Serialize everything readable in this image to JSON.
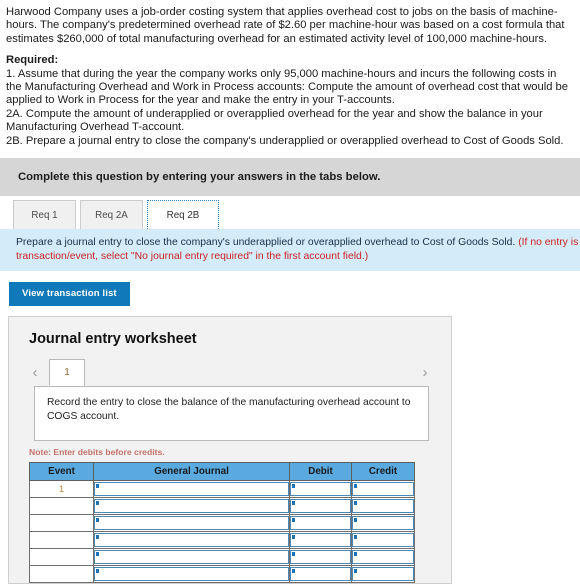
{
  "problem": {
    "paragraph1": "Harwood Company uses a job-order costing system that applies overhead cost to jobs on the basis of machine-hours. The company's predetermined overhead rate of $2.60 per machine-hour was based on a cost formula that estimates $260,000 of total manufacturing overhead for an estimated activity level of 100,000 machine-hours.",
    "required_label": "Required:",
    "requirement1": "1. Assume that during the year the company works only 95,000 machine-hours and incurs the following costs in the Manufacturing Overhead and Work in Process accounts: Compute the amount of overhead cost that would be applied to Work in Process for the year and make the entry in your T-accounts.",
    "requirement2a": "2A. Compute the amount of underapplied or overapplied overhead for the year and show the balance in your Manufacturing Overhead T-account.",
    "requirement2b": "2B. Prepare a journal entry to close the company's underapplied or overapplied overhead to Cost of Goods Sold."
  },
  "instruction_band": {
    "text": "Complete this question by entering your answers in the tabs below."
  },
  "tabs": [
    {
      "label": "Req 1",
      "active": false
    },
    {
      "label": "Req 2A",
      "active": false
    },
    {
      "label": "Req 2B",
      "active": true
    }
  ],
  "blue_band": {
    "line1_main": "Prepare a journal entry to close the company's underapplied or overapplied overhead to Cost of Goods Sold. ",
    "line1_red": "(If no entry is requir",
    "line2_red": "transaction/event, select \"No journal entry required\" in the first account field.)"
  },
  "transaction_button": {
    "label": "View transaction list"
  },
  "worksheet": {
    "title": "Journal entry worksheet",
    "prev_arrow": "‹",
    "next_arrow": "›",
    "page_number": "1",
    "prompt": "Record the entry to close the balance of the manufacturing overhead account to COGS account.",
    "note": "Note: Enter debits before credits.",
    "table": {
      "headers": [
        "Event",
        "General Journal",
        "Debit",
        "Credit"
      ],
      "rows": [
        {
          "event": "1",
          "general_journal": "",
          "debit": "",
          "credit": ""
        },
        {
          "event": "",
          "general_journal": "",
          "debit": "",
          "credit": ""
        },
        {
          "event": "",
          "general_journal": "",
          "debit": "",
          "credit": ""
        },
        {
          "event": "",
          "general_journal": "",
          "debit": "",
          "credit": ""
        },
        {
          "event": "",
          "general_journal": "",
          "debit": "",
          "credit": ""
        },
        {
          "event": "",
          "general_journal": "",
          "debit": "",
          "credit": ""
        }
      ]
    }
  },
  "colors": {
    "accent_blue": "#1079b9",
    "band_blue": "#d4ecf9",
    "band_gray": "#d6d6d6",
    "table_header_blue": "#5aaae0",
    "note_red": "#c4726b",
    "red_text": "#cc2222"
  }
}
